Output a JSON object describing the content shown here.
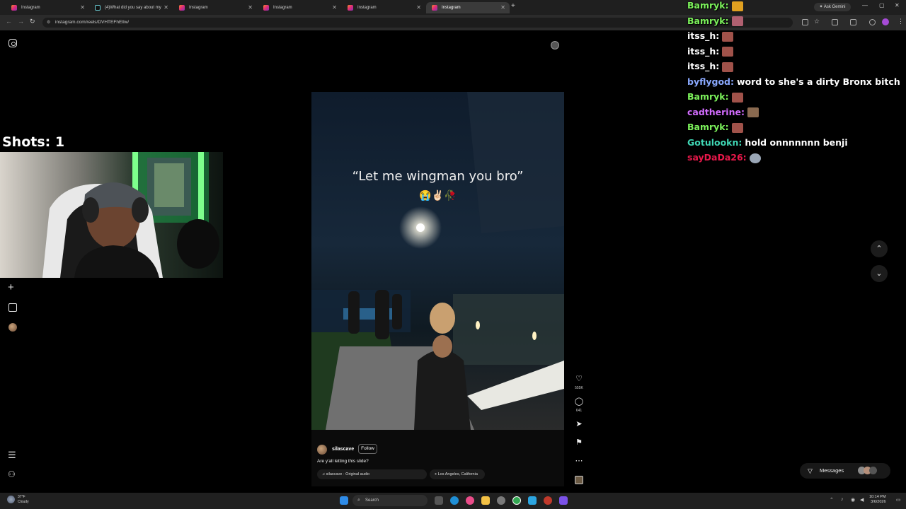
{
  "browser": {
    "tabs": [
      {
        "label": "Instagram",
        "favicon": "instagram-icon"
      },
      {
        "label": "(4)What did you say about my",
        "favicon": "tiktok-icon"
      },
      {
        "label": "Instagram",
        "favicon": "instagram-icon"
      },
      {
        "label": "Instagram",
        "favicon": "instagram-icon"
      },
      {
        "label": "Instagram",
        "favicon": "instagram-icon"
      },
      {
        "label": "Instagram",
        "favicon": "instagram-icon"
      }
    ],
    "ask_gemini": "Ask Gemini",
    "url": "instagram.com/reels/DVHTEFhEIlw/"
  },
  "overlay": {
    "shots_label": "Shots: 1"
  },
  "reel": {
    "caption_text": "“Let me wingman you bro”",
    "caption_emojis": "😭✌🏻🥀",
    "author": "silascave",
    "follow_label": "Follow",
    "description": "Are y'all letting this slide?",
    "audio": "silascave · Original audio",
    "location": "Los Angeles, California",
    "likes": "555K",
    "comments": "641"
  },
  "messages": {
    "label": "Messages"
  },
  "chat": [
    {
      "user": "Bamryk:",
      "color": "#7cf25b",
      "message": "",
      "emote": "fries-emote"
    },
    {
      "user": "Bamryk:",
      "color": "#7cf25b",
      "message": "",
      "emote": "pixel-emote"
    },
    {
      "user": "itss_h:",
      "color": "#ffffff",
      "message": "",
      "emote": "face-emote"
    },
    {
      "user": "itss_h:",
      "color": "#ffffff",
      "message": "",
      "emote": "face-emote"
    },
    {
      "user": "itss_h:",
      "color": "#ffffff",
      "message": "",
      "emote": "face-emote"
    },
    {
      "user": "byflygod:",
      "color": "#8aa9ff",
      "message": "word to she's a dirty Bronx bitch",
      "emote": ""
    },
    {
      "user": "Bamryk:",
      "color": "#7cf25b",
      "message": "",
      "emote": "face-emote"
    },
    {
      "user": "cadtherine:",
      "color": "#d36cff",
      "message": "",
      "emote": "dance-emote"
    },
    {
      "user": "Bamryk:",
      "color": "#7cf25b",
      "message": "",
      "emote": "face-emote"
    },
    {
      "user": "Gotulookn:",
      "color": "#3fd6b4",
      "message": "hold onnnnnnn benji",
      "emote": ""
    },
    {
      "user": "sayDaDa26:",
      "color": "#e8184a",
      "message": "",
      "emote": "grimace-emote"
    }
  ],
  "taskbar": {
    "weather_temp": "37°F",
    "weather_cond": "Cloudy",
    "search_placeholder": "Search",
    "time": "10:14 PM",
    "date": "3/6/2026"
  }
}
